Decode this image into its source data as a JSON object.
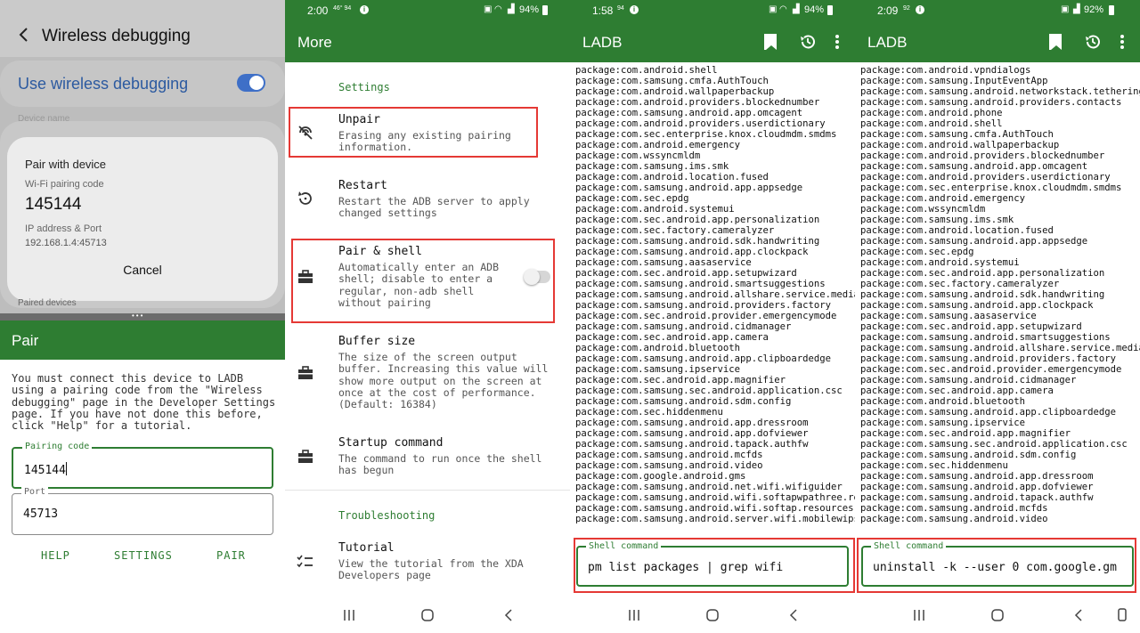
{
  "colors": {
    "brand_green": "#2e7d32",
    "highlight_red": "#e53935",
    "toggle_blue": "#3e6fc7",
    "link_blue": "#2c5aa0"
  },
  "panel1": {
    "settings": {
      "title": "Wireless debugging",
      "toggle_label": "Use wireless debugging",
      "toggle_on": true,
      "faded_text": "Device name",
      "paired_devices": "Paired devices"
    },
    "dialog": {
      "title": "Pair with device",
      "code_label": "Wi-Fi pairing code",
      "code": "145144",
      "ip_label": "IP address & Port",
      "ip": "192.168.1.4:45713",
      "cancel": "Cancel"
    },
    "pair": {
      "title": "Pair",
      "description": "You must connect this device to LADB using a pairing code from the \"Wireless debugging\" page in the Developer Settings page. If you have not done this before, click \"Help\" for a tutorial.",
      "pairing_code_label": "Pairing code",
      "pairing_code_value": "145144",
      "port_label": "Port",
      "port_value": "45713",
      "buttons": {
        "help": "HELP",
        "settings": "SETTINGS",
        "pair": "PAIR"
      }
    }
  },
  "panel2": {
    "status": {
      "time": "2:00",
      "mini": "46° 94",
      "battery": "94%"
    },
    "title": "More",
    "sections": {
      "settings": "Settings",
      "troubleshooting": "Troubleshooting"
    },
    "items": {
      "unpair": {
        "title": "Unpair",
        "subtitle": "Erasing any existing pairing information.",
        "icon": "unpair-icon"
      },
      "restart": {
        "title": "Restart",
        "subtitle": "Restart the ADB server to apply changed settings",
        "icon": "restart-icon"
      },
      "pair_shell": {
        "title": "Pair & shell",
        "subtitle": "Automatically enter an ADB shell; disable to enter a regular, non-adb shell without pairing",
        "icon": "toolbox-icon",
        "enabled": false
      },
      "buffer": {
        "title": "Buffer size",
        "subtitle": "The size of the screen output buffer. Increasing this value will show more output on the screen at once at the cost of performance. (Default: 16384)",
        "icon": "toolbox-icon"
      },
      "startup": {
        "title": "Startup command",
        "subtitle": "The command to run once the shell has begun",
        "icon": "toolbox-icon"
      },
      "tutorial": {
        "title": "Tutorial",
        "subtitle": "View the tutorial from the XDA Developers page",
        "icon": "checklist-icon"
      }
    }
  },
  "panel3": {
    "status": {
      "time": "1:58",
      "mini": "94",
      "battery": "94%"
    },
    "title": "LADB",
    "log": "package:com.android.shell\npackage:com.samsung.cmfa.AuthTouch\npackage:com.android.wallpaperbackup\npackage:com.android.providers.blockednumber\npackage:com.samsung.android.app.omcagent\npackage:com.android.providers.userdictionary\npackage:com.sec.enterprise.knox.cloudmdm.smdms\npackage:com.android.emergency\npackage:com.wssyncmldm\npackage:com.samsung.ims.smk\npackage:com.android.location.fused\npackage:com.samsung.android.app.appsedge\npackage:com.sec.epdg\npackage:com.android.systemui\npackage:com.sec.android.app.personalization\npackage:com.sec.factory.cameralyzer\npackage:com.samsung.android.sdk.handwriting\npackage:com.samsung.android.app.clockpack\npackage:com.samsung.aasaservice\npackage:com.sec.android.app.setupwizard\npackage:com.samsung.android.smartsuggestions\npackage:com.samsung.android.allshare.service.mediashare\npackage:com.samsung.android.providers.factory\npackage:com.sec.android.provider.emergencymode\npackage:com.samsung.android.cidmanager\npackage:com.sec.android.app.camera\npackage:com.android.bluetooth\npackage:com.samsung.android.app.clipboardedge\npackage:com.samsung.ipservice\npackage:com.sec.android.app.magnifier\npackage:com.samsung.sec.android.application.csc\npackage:com.samsung.android.sdm.config\npackage:com.sec.hiddenmenu\npackage:com.samsung.android.app.dressroom\npackage:com.samsung.android.app.dofviewer\npackage:com.samsung.android.tapack.authfw\npackage:com.samsung.android.mcfds\npackage:com.samsung.android.video\npackage:com.google.android.gms\npackage:com.samsung.android.net.wifi.wifiguider\npackage:com.samsung.android.wifi.softapwpathree.resources\npackage:com.samsung.android.wifi.softap.resources\npackage:com.samsung.android.server.wifi.mobilewips",
    "shell_label": "Shell command",
    "shell_value": "pm list packages | grep wifi"
  },
  "panel4": {
    "status": {
      "time": "2:09",
      "mini": "92",
      "battery": "92%"
    },
    "title": "LADB",
    "log": "package:com.android.vpndialogs\npackage:com.samsung.InputEventApp\npackage:com.samsung.android.networkstack.tethering.overlay\npackage:com.samsung.android.providers.contacts\npackage:com.android.phone\npackage:com.android.shell\npackage:com.samsung.cmfa.AuthTouch\npackage:com.android.wallpaperbackup\npackage:com.android.providers.blockednumber\npackage:com.samsung.android.app.omcagent\npackage:com.android.providers.userdictionary\npackage:com.sec.enterprise.knox.cloudmdm.smdms\npackage:com.android.emergency\npackage:com.wssyncmldm\npackage:com.samsung.ims.smk\npackage:com.android.location.fused\npackage:com.samsung.android.app.appsedge\npackage:com.sec.epdg\npackage:com.android.systemui\npackage:com.sec.android.app.personalization\npackage:com.sec.factory.cameralyzer\npackage:com.samsung.android.sdk.handwriting\npackage:com.samsung.android.app.clockpack\npackage:com.samsung.aasaservice\npackage:com.sec.android.app.setupwizard\npackage:com.samsung.android.smartsuggestions\npackage:com.samsung.android.allshare.service.mediashare\npackage:com.samsung.android.providers.factory\npackage:com.sec.android.provider.emergencymode\npackage:com.samsung.android.cidmanager\npackage:com.sec.android.app.camera\npackage:com.android.bluetooth\npackage:com.samsung.android.app.clipboardedge\npackage:com.samsung.ipservice\npackage:com.sec.android.app.magnifier\npackage:com.samsung.sec.android.application.csc\npackage:com.samsung.android.sdm.config\npackage:com.sec.hiddenmenu\npackage:com.samsung.android.app.dressroom\npackage:com.samsung.android.app.dofviewer\npackage:com.samsung.android.tapack.authfw\npackage:com.samsung.android.mcfds\npackage:com.samsung.android.video",
    "shell_label": "Shell command",
    "shell_value": "uninstall -k --user 0 com.google.gm"
  }
}
